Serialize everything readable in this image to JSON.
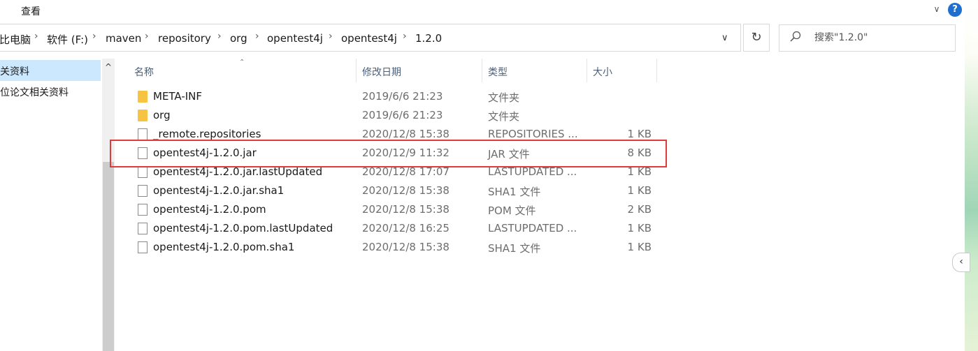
{
  "ribbon": {
    "view_label": "查看",
    "collapse_glyph": "∨",
    "help_glyph": "?"
  },
  "address": {
    "breadcrumbs": [
      "比电脑",
      "软件 (F:)",
      "maven",
      "repository",
      "org",
      "opentest4j",
      "opentest4j",
      "1.2.0"
    ],
    "separator_glyph": "›",
    "dropdown_glyph": "∨",
    "refresh_glyph": "↻"
  },
  "search": {
    "placeholder": "搜索\"1.2.0\""
  },
  "nav": {
    "items": [
      {
        "label": "关资料",
        "selected": true
      },
      {
        "label": "位论文相关资料",
        "selected": false
      }
    ],
    "scroll_up_glyph": "^"
  },
  "columns": {
    "name": "名称",
    "date": "修改日期",
    "type": "类型",
    "size": "大小"
  },
  "files": [
    {
      "name": "META-INF",
      "date": "2019/6/6 21:23",
      "type": "文件夹",
      "size": "",
      "kind": "folder"
    },
    {
      "name": "org",
      "date": "2019/6/6 21:23",
      "type": "文件夹",
      "size": "",
      "kind": "folder"
    },
    {
      "name": "_remote.repositories",
      "date": "2020/12/8 15:38",
      "type": "REPOSITORIES ...",
      "size": "1 KB",
      "kind": "file"
    },
    {
      "name": "opentest4j-1.2.0.jar",
      "date": "2020/12/9 11:32",
      "type": "JAR 文件",
      "size": "8 KB",
      "kind": "file"
    },
    {
      "name": "opentest4j-1.2.0.jar.lastUpdated",
      "date": "2020/12/8 17:07",
      "type": "LASTUPDATED ...",
      "size": "1 KB",
      "kind": "file"
    },
    {
      "name": "opentest4j-1.2.0.jar.sha1",
      "date": "2020/12/8 15:38",
      "type": "SHA1 文件",
      "size": "1 KB",
      "kind": "file"
    },
    {
      "name": "opentest4j-1.2.0.pom",
      "date": "2020/12/8 15:38",
      "type": "POM 文件",
      "size": "2 KB",
      "kind": "file"
    },
    {
      "name": "opentest4j-1.2.0.pom.lastUpdated",
      "date": "2020/12/8 16:25",
      "type": "LASTUPDATED ...",
      "size": "1 KB",
      "kind": "file"
    },
    {
      "name": "opentest4j-1.2.0.pom.sha1",
      "date": "2020/12/8 15:38",
      "type": "SHA1 文件",
      "size": "1 KB",
      "kind": "file"
    }
  ],
  "colors": {
    "highlight": "#e03a3a",
    "selection": "#cce8ff",
    "folder": "#f6c343",
    "header_text": "#4c607a"
  },
  "side_handle_glyph": "‹"
}
